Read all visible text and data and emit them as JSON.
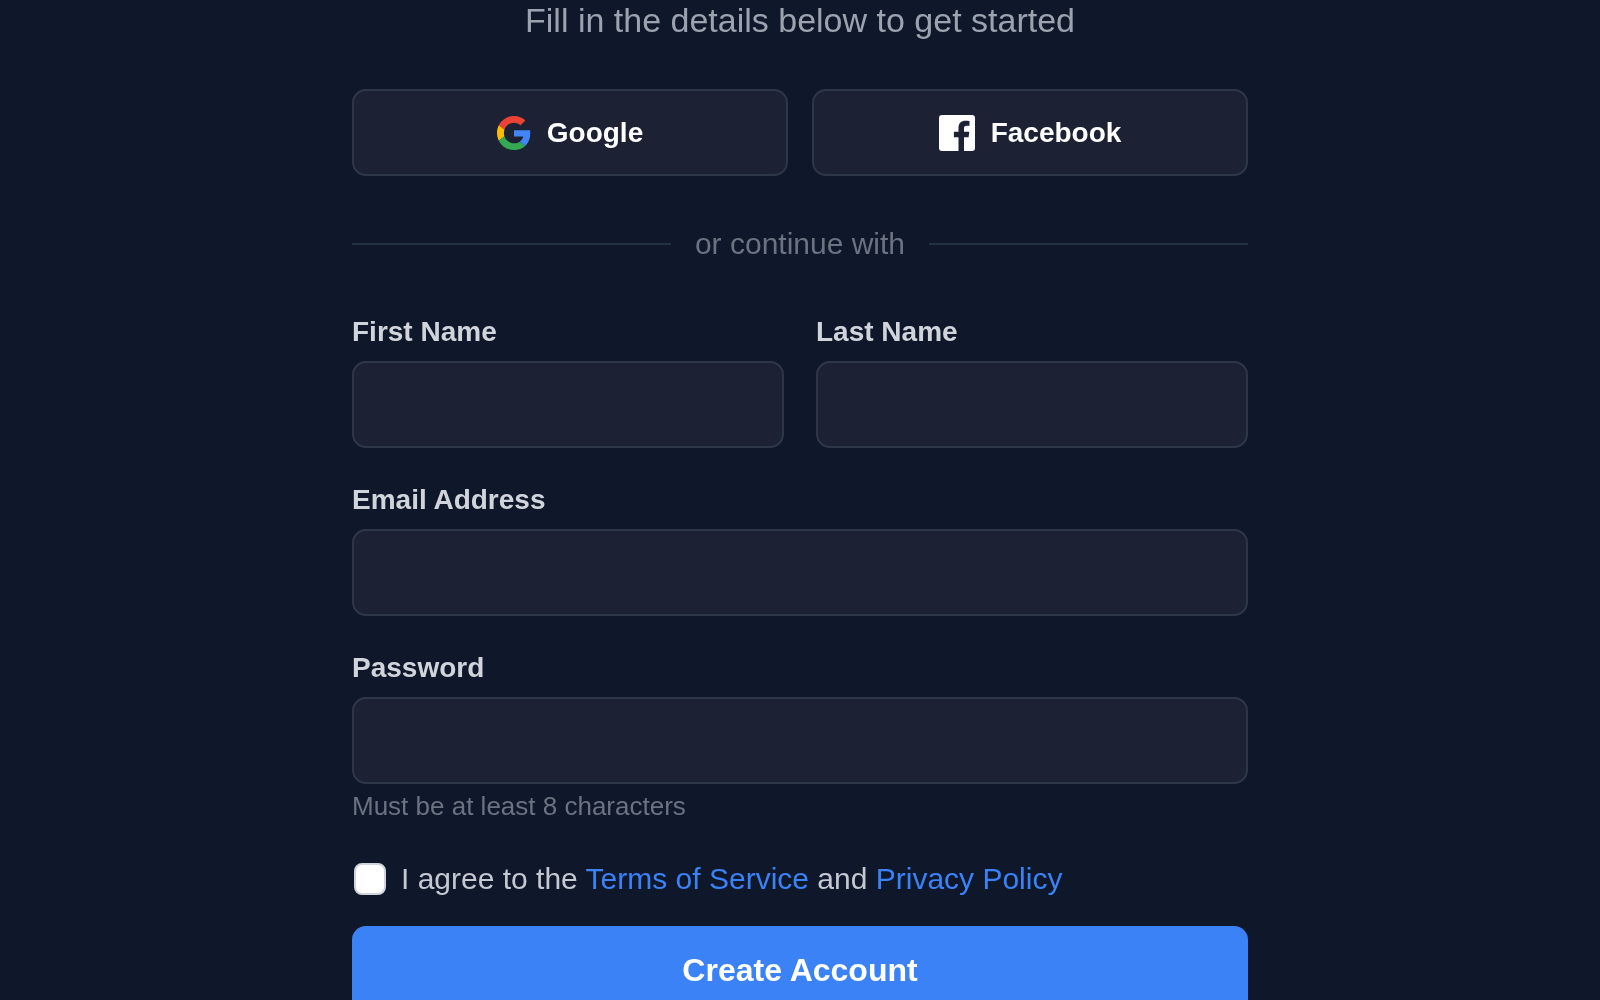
{
  "subtitle": "Fill in the details below to get started",
  "social_buttons": [
    {
      "kind": "google",
      "label": "Google"
    },
    {
      "kind": "facebook",
      "label": "Facebook"
    }
  ],
  "divider": "or continue with",
  "field_rows": [
    {
      "fields": [
        {
          "label": "First Name"
        },
        {
          "label": "Last Name"
        }
      ]
    },
    {
      "fields": [
        {
          "label": "Email Address"
        }
      ]
    },
    {
      "fields": [
        {
          "label": "Password",
          "hint": "Must be at least 8 characters"
        }
      ]
    }
  ],
  "terms": {
    "checked": false,
    "parts": [
      {
        "kind": "text",
        "text": "I agree to the"
      },
      {
        "kind": "link",
        "text": "Terms of Service"
      },
      {
        "kind": "text",
        "text": "and"
      },
      {
        "kind": "link",
        "text": "Privacy Policy"
      }
    ]
  },
  "submit": "Create Account"
}
